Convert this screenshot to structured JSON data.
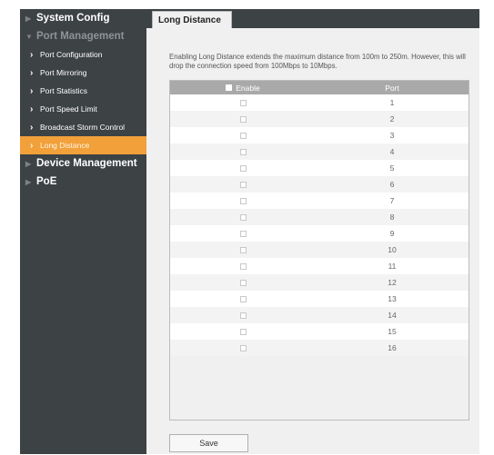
{
  "sidebar": {
    "system_config": "System Config",
    "port_management": "Port Management",
    "sub_items": [
      {
        "label": "Port Configuration"
      },
      {
        "label": "Port Mirroring"
      },
      {
        "label": "Port Statistics"
      },
      {
        "label": "Port Speed Limit"
      },
      {
        "label": "Broadcast Storm Control"
      },
      {
        "label": "Long Distance"
      }
    ],
    "device_management": "Device Management",
    "poe": "PoE"
  },
  "tab": {
    "label": "Long Distance"
  },
  "description": "Enabling Long Distance extends the maximum distance from 100m to 250m. However, this will drop the connection speed from 100Mbps to 10Mbps.",
  "table": {
    "header_enable": "Enable",
    "header_port": "Port",
    "ports": [
      "1",
      "2",
      "3",
      "4",
      "5",
      "6",
      "7",
      "8",
      "9",
      "10",
      "11",
      "12",
      "13",
      "14",
      "15",
      "16"
    ]
  },
  "save_label": "Save",
  "colors": {
    "sidebar_bg": "#3d4245",
    "active_item": "#f1a03a",
    "header_bg": "#a9a9a9",
    "content_bg": "#f0f0f0"
  }
}
